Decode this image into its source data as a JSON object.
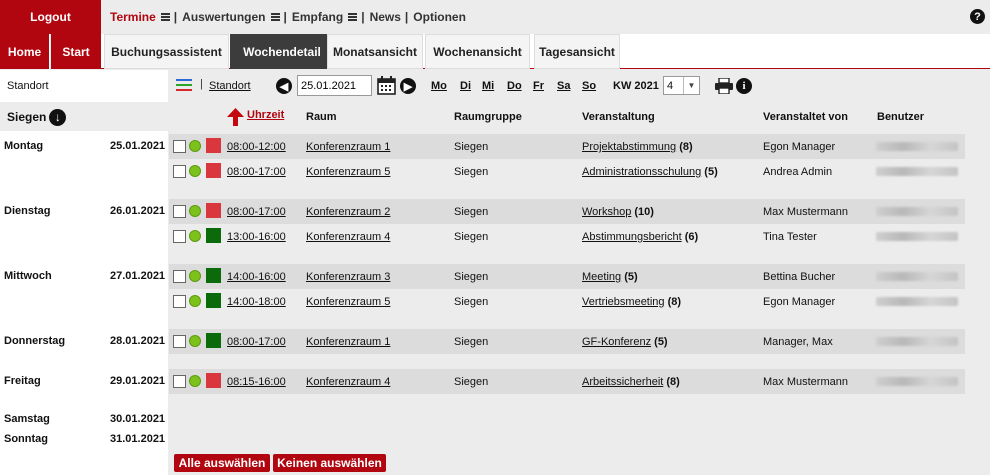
{
  "nav": {
    "logout": "Logout",
    "items": [
      {
        "label": "Termine"
      },
      {
        "label": "Auswertungen"
      },
      {
        "label": "Empfang"
      },
      {
        "label": "News"
      },
      {
        "label": "Optionen"
      }
    ],
    "help": "?"
  },
  "subnav": {
    "home": "Home",
    "start": "Start",
    "tabs": [
      "Buchungsassistent",
      "Wochendetail",
      "Monatsansicht",
      "Wochenansicht",
      "Tagesansicht"
    ]
  },
  "toolbar": {
    "standort_label": "Standort",
    "standort_link": "Standort",
    "date": "25.01.2021",
    "days": [
      "Mo",
      "Di",
      "Mi",
      "Do",
      "Fr",
      "Sa",
      "So"
    ],
    "kw_label": "KW 2021",
    "kw_value": "4"
  },
  "location": "Siegen",
  "columns": {
    "time": "Uhrzeit",
    "room": "Raum",
    "group": "Raumgruppe",
    "event": "Veranstaltung",
    "by": "Veranstaltet von",
    "user": "Benutzer"
  },
  "days": [
    {
      "name": "Montag",
      "date": "25.01.2021"
    },
    {
      "name": "Dienstag",
      "date": "26.01.2021"
    },
    {
      "name": "Mittwoch",
      "date": "27.01.2021"
    },
    {
      "name": "Donnerstag",
      "date": "28.01.2021"
    },
    {
      "name": "Freitag",
      "date": "29.01.2021"
    },
    {
      "name": "Samstag",
      "date": "30.01.2021"
    },
    {
      "name": "Sonntag",
      "date": "31.01.2021"
    }
  ],
  "rows": [
    {
      "time": "08:00-12:00",
      "room": "Konferenzraum 1",
      "group": "Siegen",
      "event": "Projektabstimmung",
      "count": "(8)",
      "by": "Egon Manager",
      "status": "red"
    },
    {
      "time": "08:00-17:00",
      "room": "Konferenzraum 5",
      "group": "Siegen",
      "event": "Administrationsschulung",
      "count": "(5)",
      "by": "Andrea Admin",
      "status": "red"
    },
    {
      "time": "08:00-17:00",
      "room": "Konferenzraum 2",
      "group": "Siegen",
      "event": "Workshop",
      "count": "(10)",
      "by": "Max Mustermann",
      "status": "red"
    },
    {
      "time": "13:00-16:00",
      "room": "Konferenzraum 4",
      "group": "Siegen",
      "event": "Abstimmungsbericht",
      "count": "(6)",
      "by": "Tina Tester",
      "status": "green"
    },
    {
      "time": "14:00-16:00",
      "room": "Konferenzraum 3",
      "group": "Siegen",
      "event": "Meeting",
      "count": "(5)",
      "by": "Bettina Bucher",
      "status": "green"
    },
    {
      "time": "14:00-18:00",
      "room": "Konferenzraum 5",
      "group": "Siegen",
      "event": "Vertriebsmeeting",
      "count": "(8)",
      "by": "Egon Manager",
      "status": "green"
    },
    {
      "time": "08:00-17:00",
      "room": "Konferenzraum 1",
      "group": "Siegen",
      "event": "GF-Konferenz",
      "count": "(5)",
      "by": "Manager, Max",
      "status": "green"
    },
    {
      "time": "08:15-16:00",
      "room": "Konferenzraum 4",
      "group": "Siegen",
      "event": "Arbeitssicherheit",
      "count": "(8)",
      "by": "Max Mustermann",
      "status": "red"
    }
  ],
  "colors": {
    "brand": "#b1060f",
    "status_red": "#d9363e",
    "status_green": "#0b6b0b",
    "available_dot": "#7cc21a"
  },
  "buttons": {
    "select_all": "Alle auswählen",
    "select_none": "Keinen auswählen"
  }
}
